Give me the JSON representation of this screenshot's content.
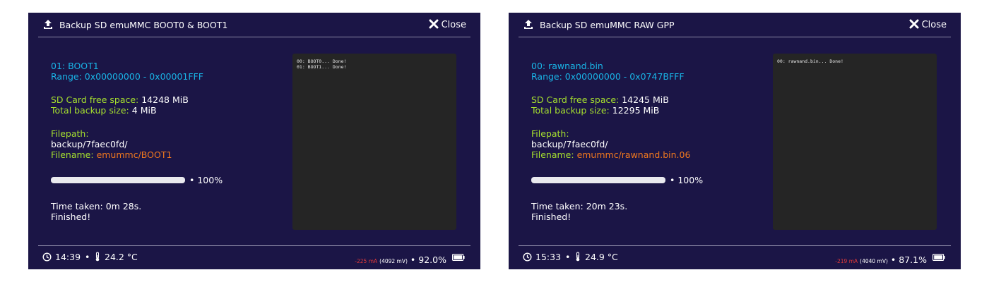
{
  "left": {
    "title": "Backup SD emuMMC BOOT0 & BOOT1",
    "close_label": "Close",
    "part_label": "01: BOOT1",
    "range_label": "Range: 0x00000000 - 0x00001FFF",
    "free_label": "SD Card free space:",
    "free_value": "14248 MiB",
    "total_label": "Total backup size:",
    "total_value": "4 MiB",
    "filepath_label": "Filepath:",
    "filepath_value": "backup/7faec0fd/",
    "filename_label": "Filename:",
    "filename_value": "emummc/BOOT1",
    "progress": 100,
    "progress_label": "• 100%",
    "time_taken": "Time taken: 0m 28s.",
    "finished": "Finished!",
    "log": [
      "00: BOOT0... Done!",
      "01: BOOT1... Done!"
    ],
    "status": {
      "time": "14:39",
      "sep1": "•",
      "temp": "24.2 °C",
      "current": "-225 mA",
      "voltage": "(4092 mV)",
      "sep2": "•",
      "battery": "92.0%"
    }
  },
  "right": {
    "title": "Backup SD emuMMC RAW GPP",
    "close_label": "Close",
    "part_label": "00: rawnand.bin",
    "range_label": "Range: 0x00000000 - 0x0747BFFF",
    "free_label": "SD Card free space:",
    "free_value": "14245 MiB",
    "total_label": "Total backup size:",
    "total_value": "12295 MiB",
    "filepath_label": "Filepath:",
    "filepath_value": "backup/7faec0fd/",
    "filename_label": "Filename:",
    "filename_value": "emummc/rawnand.bin.06",
    "progress": 100,
    "progress_label": "• 100%",
    "time_taken": "Time taken: 20m 23s.",
    "finished": "Finished!",
    "log": [
      "00: rawnand.bin... Done!"
    ],
    "status": {
      "time": "15:33",
      "sep1": "•",
      "temp": "24.9 °C",
      "current": "-219 mA",
      "voltage": "(4040 mV)",
      "sep2": "•",
      "battery": "87.1%"
    }
  },
  "colors": {
    "background": "#1b1546",
    "cyan": "#19b4e6",
    "green": "#a6e02e",
    "orange": "#f0781e",
    "current_red": "#e03a3a",
    "log_bg": "#252525"
  },
  "icons": [
    "upload-icon",
    "close-icon",
    "clock-icon",
    "thermometer-icon",
    "battery-icon"
  ]
}
